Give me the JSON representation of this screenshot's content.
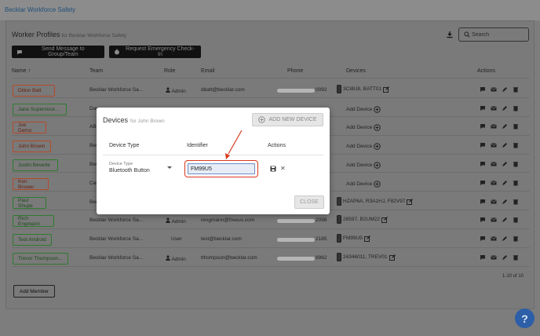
{
  "app": {
    "title": "Becklar Workforce Safety"
  },
  "page": {
    "title": "Worker Profiles",
    "subtitle": "for Becklar Workforce Safety",
    "search_placeholder": "Search",
    "send_message_label": "Send Message to Group/Team",
    "emergency_checkin_label": "Request Emergency Check-In",
    "columns": {
      "name": "Name",
      "team": "Team",
      "role": "Role",
      "email": "Email",
      "phone": "Phone",
      "devices": "Devices",
      "actions": "Actions"
    },
    "pagination": "1-10 of 10",
    "add_member_label": "Add Member"
  },
  "rows": [
    {
      "name": "Dillon Batt",
      "team": "Becklar Workforce Sa...",
      "role": "Admin",
      "email": "dbatt@becklar.com",
      "phone_end": "0092",
      "devices": "3CI8U8,   BATT01"
    },
    {
      "name": "Jane Supervisor...",
      "team": "Day",
      "role": "",
      "email": "",
      "phone_end": "",
      "devices": "Add Device"
    },
    {
      "name": "Joe Demo",
      "team": "ABC",
      "role": "",
      "email": "",
      "phone_end": "",
      "devices": "Add Device"
    },
    {
      "name": "John Brown",
      "team": "Bec",
      "role": "",
      "email": "",
      "phone_end": "",
      "devices": "Add Device"
    },
    {
      "name": "Justin Beverle",
      "team": "Bec",
      "role": "",
      "email": "",
      "phone_end": "",
      "devices": "Add Device"
    },
    {
      "name": "Ken Brower",
      "team": "Cen",
      "role": "",
      "email": "",
      "phone_end": "",
      "devices": "Add Device"
    },
    {
      "name": "Paul Shupe",
      "team": "Bec",
      "role": "",
      "email": "",
      "phone_end": "",
      "devices": "HZAP6A,   R3A1HJ,   F82V97"
    },
    {
      "name": "Rich Engmann",
      "team": "Becklar Workforce Sa...",
      "role": "Admin",
      "email": "rengmann@freeus.com",
      "phone_end": "2098",
      "devices": "28597,   B2UM22"
    },
    {
      "name": "Test Android",
      "team": "Becklar Workforce Sa...",
      "role": "User",
      "email": "test@becklar.com",
      "phone_end": "2185",
      "devices": "FM99U5"
    },
    {
      "name": "Trevor Thompson...",
      "team": "Becklar Workforce Sa...",
      "role": "Admin",
      "email": "tthompson@becklar.com",
      "phone_end": "8962",
      "devices": "24346011,   TREV01"
    }
  ],
  "modal": {
    "title": "Devices",
    "subtitle": "for John Brown",
    "add_new_label": "ADD NEW DEVICE",
    "col_device_type": "Device Type",
    "col_identifier": "Identifier",
    "col_actions": "Actions",
    "device_type_label": "Device Type",
    "device_type_value": "Bluetooth Button",
    "identifier_value": "FM99U5",
    "close_label": "CLOSE"
  },
  "colors": {
    "accent_blue": "#2d5ea8",
    "highlight_red": "#d9381e",
    "green_outline": "#2f7a2f",
    "red_outline": "#b54a2a"
  }
}
